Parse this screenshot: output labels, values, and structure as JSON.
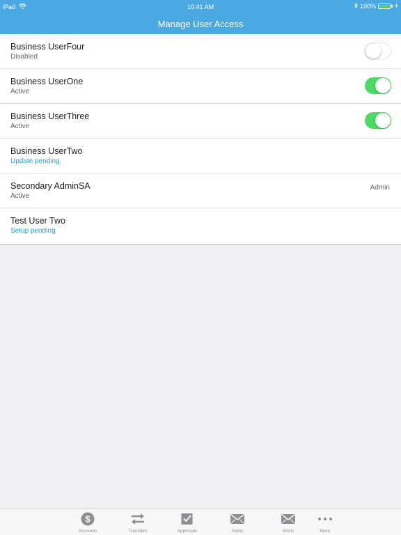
{
  "status_bar": {
    "device": "iPad",
    "time": "10:41 AM",
    "battery": "100%"
  },
  "header": {
    "title": "Manage User Access"
  },
  "users": [
    {
      "name": "Business UserFour",
      "status": "Disabled",
      "status_type": "normal",
      "toggle": "off",
      "role": ""
    },
    {
      "name": "Business UserOne",
      "status": "Active",
      "status_type": "normal",
      "toggle": "on",
      "role": ""
    },
    {
      "name": "Business UserThree",
      "status": "Active",
      "status_type": "normal",
      "toggle": "on",
      "role": ""
    },
    {
      "name": "Business UserTwo",
      "status": "Update pending",
      "status_type": "pending",
      "toggle": "none",
      "role": ""
    },
    {
      "name": "Secondary AdminSA",
      "status": "Active",
      "status_type": "normal",
      "toggle": "none",
      "role": "Admin"
    },
    {
      "name": "Test User Two",
      "status": "Setup pending",
      "status_type": "pending",
      "toggle": "none",
      "role": ""
    }
  ],
  "tabs": [
    {
      "label": "Accounts",
      "icon": "dollar-circle-icon"
    },
    {
      "label": "Transfers",
      "icon": "transfer-arrows-icon"
    },
    {
      "label": "Approvals",
      "icon": "checkbox-icon"
    },
    {
      "label": "Alerts",
      "icon": "envelope-icon"
    },
    {
      "label": "Alerts",
      "icon": "envelope-icon"
    },
    {
      "label": "More",
      "icon": "more-dots-icon"
    }
  ],
  "colors": {
    "header": "#4aa9e3",
    "toggle_on": "#4cd964",
    "pending_text": "#2a9fd6",
    "tab_icon": "#8e8e93"
  }
}
